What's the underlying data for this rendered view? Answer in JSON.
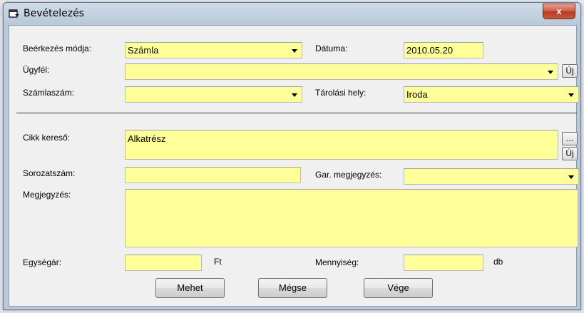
{
  "window": {
    "title": "Bevételezés",
    "close_glyph": "x"
  },
  "labels": {
    "arrival_mode": "Beérkezés módja:",
    "date": "Dátuma:",
    "customer": "Ügyfél:",
    "invoice_number": "Számlaszám:",
    "storage_place": "Tárolási hely:",
    "item_search": "Cikk kereső:",
    "serial_number": "Sorozatszám:",
    "warranty_note": "Gar. megjegyzés:",
    "note": "Megjegyzés:",
    "unit_price": "Egységár:",
    "unit_price_suffix": "Ft",
    "quantity": "Mennyiség:",
    "quantity_suffix": "db"
  },
  "values": {
    "arrival_mode": "Számla",
    "date": "2010.05.20",
    "customer": "",
    "invoice_number": "",
    "storage_place": "Iroda",
    "item_search": "Alkatrész",
    "serial_number": "",
    "warranty_note": "",
    "note": "",
    "unit_price": "",
    "quantity": ""
  },
  "small_buttons": {
    "new_label": "Új",
    "browse_label": "..."
  },
  "buttons": {
    "go": "Mehet",
    "cancel": "Mégse",
    "end": "Vége"
  },
  "colors": {
    "field_bg": "#ffff99",
    "close_red": "#c9573f"
  }
}
